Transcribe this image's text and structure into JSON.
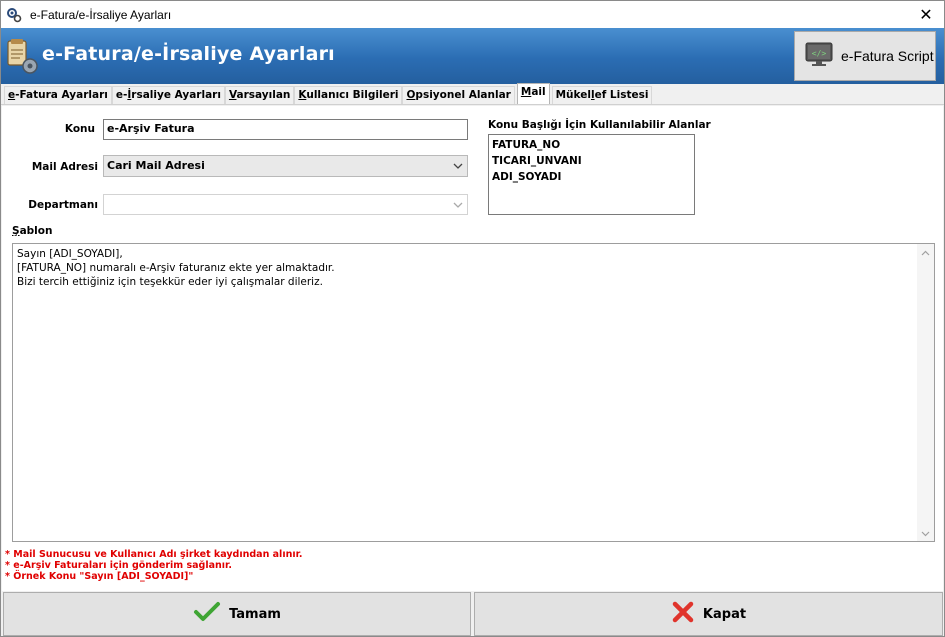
{
  "window": {
    "title": "e-Fatura/e-İrsaliye Ayarları",
    "close_glyph": "✕"
  },
  "banner": {
    "heading": "e-Fatura/e-İrsaliye Ayarları",
    "script_button_label": "e-Fatura Script",
    "bg_color": "#2b6db3"
  },
  "tabs": [
    {
      "label_first": "e",
      "label_rest": "-Fatura Ayarları"
    },
    {
      "label_first": "e-",
      "label_mid": "İ",
      "label_rest": "rsaliye Ayarları"
    },
    {
      "label_first": "V",
      "label_rest": "arsayılan"
    },
    {
      "label_first": "K",
      "label_rest": "ullanıcı Bilgileri"
    },
    {
      "label_first": "O",
      "label_rest": "psiyonel Alanlar"
    },
    {
      "label_first": "M",
      "label_rest": "ail",
      "active": true
    },
    {
      "label_first": "Mükel",
      "label_mid": "l",
      "label_rest": "ef Listesi"
    }
  ],
  "form": {
    "konu_label": "Konu",
    "konu_value": "e-Arşiv Fatura",
    "mail_adresi_label": "Mail Adresi",
    "mail_adresi_value": "Cari Mail Adresi",
    "departman_label": "Departmanı",
    "departman_value": "",
    "fields_list_label": "Konu Başlığı İçin Kullanılabilir Alanlar",
    "fields_list": [
      "FATURA_NO",
      "TICARI_UNVANI",
      "ADI_SOYADI"
    ],
    "sablon_label_first": "Ş",
    "sablon_label_rest": "ablon",
    "sablon_lines": [
      "Sayın [ADI_SOYADI],",
      "[FATURA_NO] numaralı e-Arşiv faturanız ekte yer almaktadır.",
      "Bizi tercih ettiğiniz için teşekkür eder iyi çalışmalar dileriz."
    ]
  },
  "notes": [
    "* Mail Sunucusu ve Kullanıcı Adı şirket kaydından alınır.",
    "* e-Arşiv Faturaları için gönderim sağlanır.",
    "* Örnek Konu  \"Sayın [ADI_SOYADI]\""
  ],
  "buttons": {
    "ok_label": "Tamam",
    "close_label": "Kapat"
  },
  "colors": {
    "note_red": "#e00000",
    "check_green": "#3fa534",
    "cross_red": "#e0342c"
  }
}
